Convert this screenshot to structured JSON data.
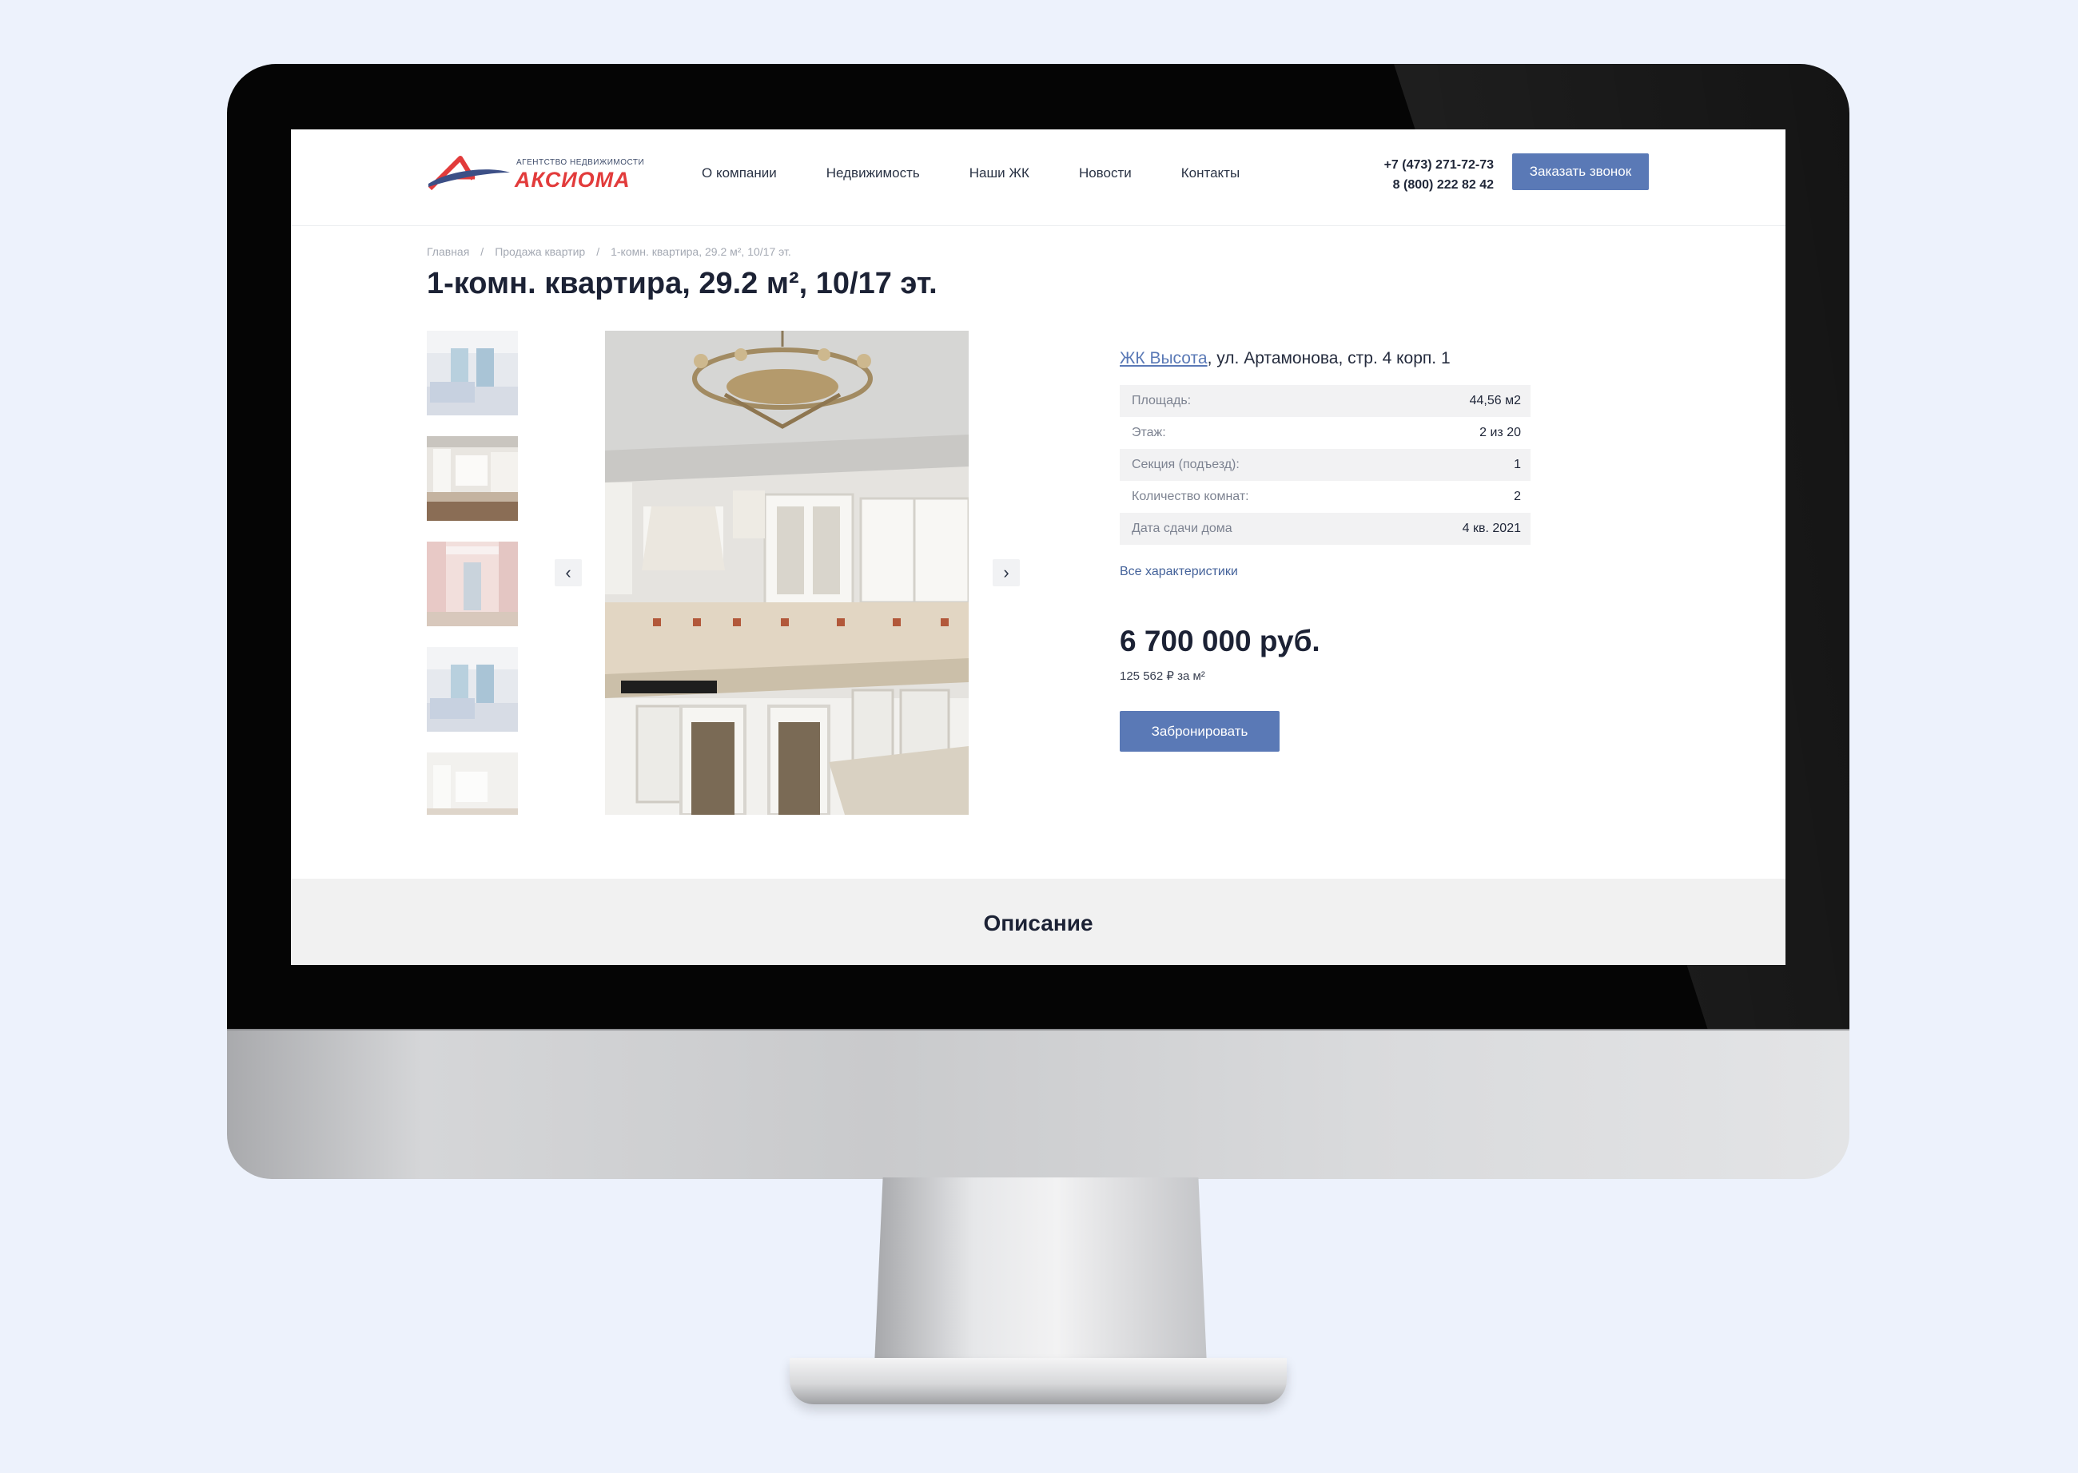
{
  "brand": {
    "tagline": "АГЕНТСТВО НЕДВИЖИМОСТИ",
    "name": "АКСИОМА",
    "accent_red": "#e23b3b",
    "accent_blue": "#5a79b6"
  },
  "nav": {
    "items": [
      "О компании",
      "Недвижимость",
      "Наши ЖК",
      "Новости",
      "Контакты"
    ]
  },
  "header": {
    "phone_1": "+7 (473) 271-72-73",
    "phone_2": "8 (800) 222 82 42",
    "callback_label": "Заказать звонок"
  },
  "breadcrumb": {
    "items": [
      "Главная",
      "Продажа квартир",
      "1-комн. квартира, 29.2 м², 10/17 эт."
    ],
    "separator": "/"
  },
  "listing": {
    "title": "1-комн. квартира, 29.2 м², 10/17 эт.",
    "complex_link": "ЖК Высота",
    "address_rest": ", ул. Артамонова, стр. 4 корп. 1",
    "specs": [
      {
        "label": "Площадь:",
        "value": "44,56 м2"
      },
      {
        "label": "Этаж:",
        "value": "2 из 20"
      },
      {
        "label": "Секция (подъезд):",
        "value": "1"
      },
      {
        "label": "Количество комнат:",
        "value": "2"
      },
      {
        "label": "Дата сдачи дома",
        "value": "4 кв. 2021"
      }
    ],
    "all_specs_label": "Все характеристики",
    "price": "6 700 000 руб.",
    "price_per_sqm": "125 562 ₽ за м²",
    "book_label": "Забронировать"
  },
  "gallery": {
    "prev_icon": "chevron-left-icon",
    "next_icon": "chevron-right-icon",
    "prev_glyph": "‹",
    "next_glyph": "›",
    "thumbnails": [
      "bedroom",
      "kitchen",
      "hallway",
      "bedroom",
      "kitchen"
    ],
    "main_photo": "kitchen with chandelier"
  },
  "description": {
    "heading": "Описание"
  }
}
